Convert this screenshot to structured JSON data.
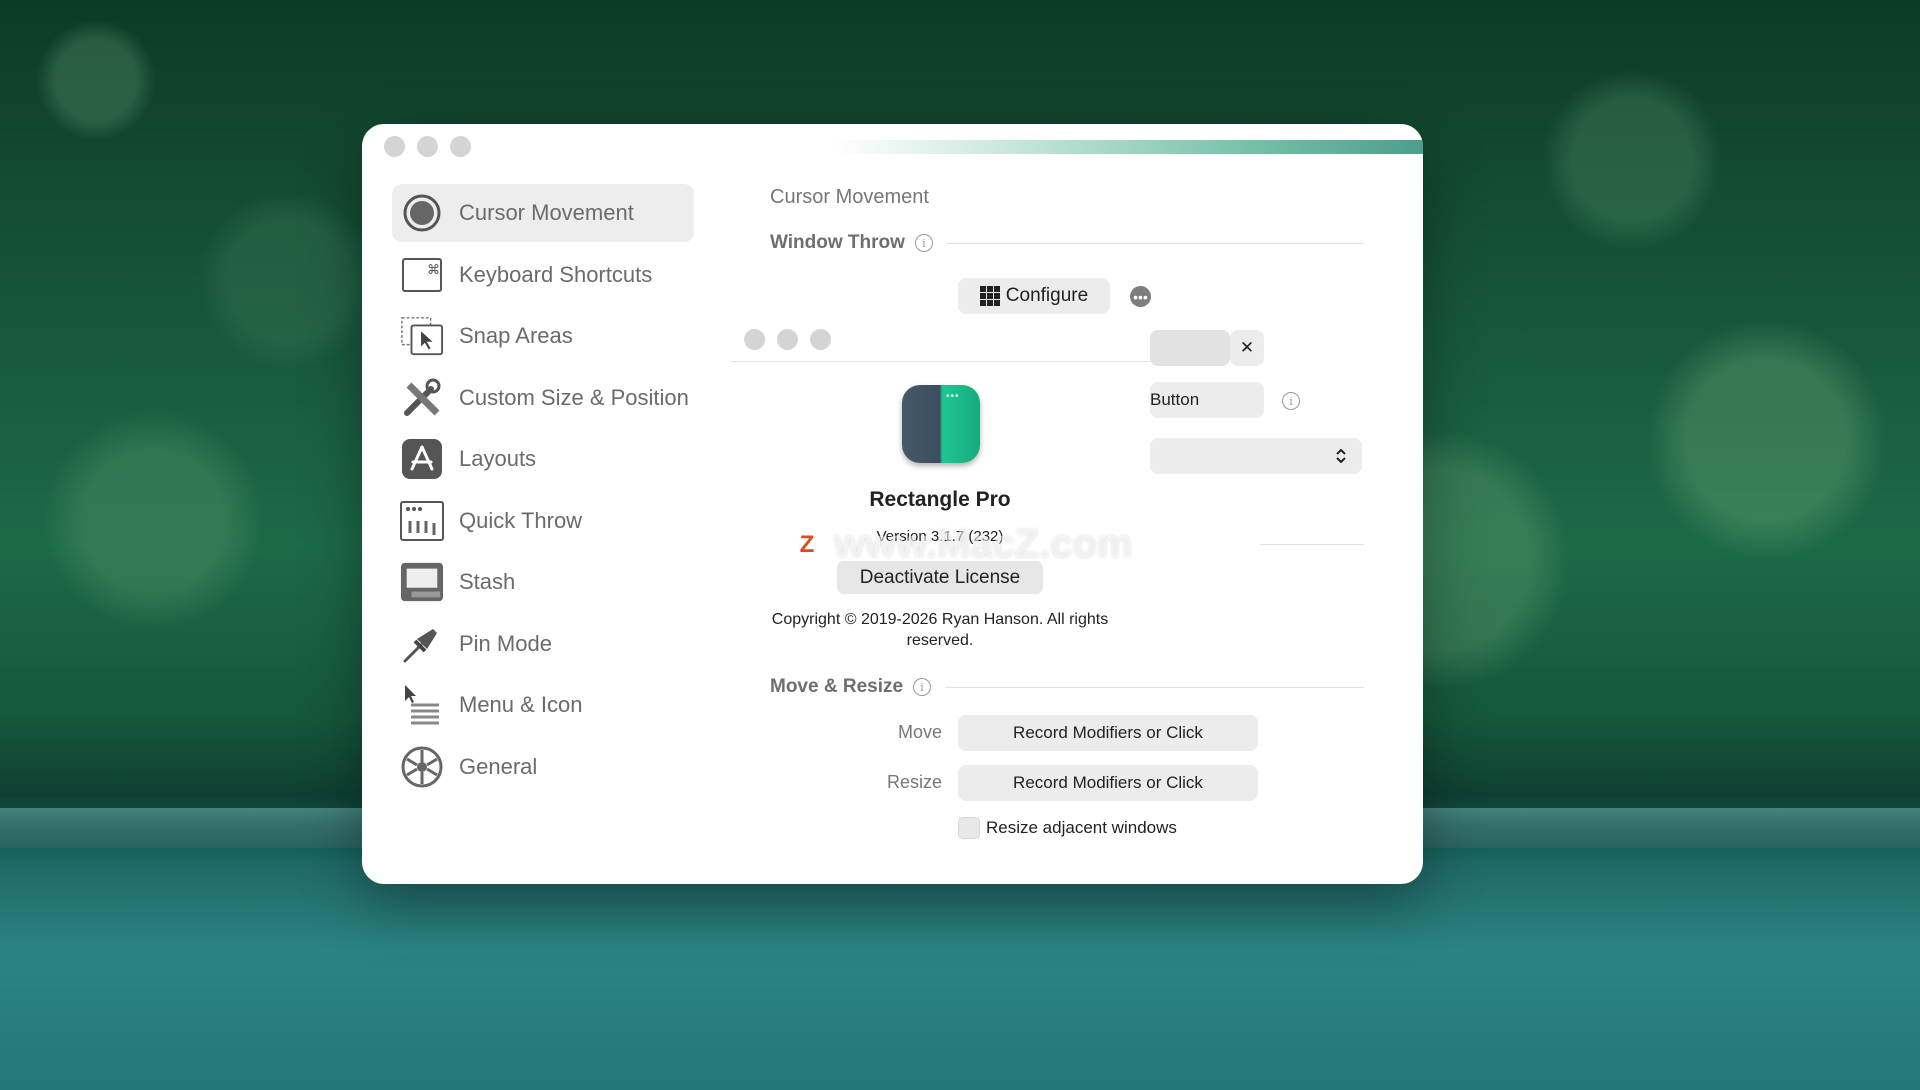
{
  "window": {
    "sidebar": {
      "items": [
        {
          "label": "Cursor Movement",
          "icon": "cursor-movement-icon",
          "selected": true
        },
        {
          "label": "Keyboard Shortcuts",
          "icon": "command-key-icon"
        },
        {
          "label": "Snap Areas",
          "icon": "snap-areas-icon"
        },
        {
          "label": "Custom Size & Position",
          "icon": "wrench-ruler-icon"
        },
        {
          "label": "Layouts",
          "icon": "layouts-icon"
        },
        {
          "label": "Quick Throw",
          "icon": "quick-throw-icon"
        },
        {
          "label": "Stash",
          "icon": "stash-icon"
        },
        {
          "label": "Pin Mode",
          "icon": "pin-icon"
        },
        {
          "label": "Menu & Icon",
          "icon": "menu-icon"
        },
        {
          "label": "General",
          "icon": "gear-icon"
        }
      ]
    },
    "content": {
      "page_title": "Cursor Movement",
      "window_throw": {
        "heading": "Window Throw",
        "configure_label": "Configure",
        "partial_button": "Button",
        "clear_symbol": "✕",
        "select_symbol": "⌃⌄"
      },
      "move_resize": {
        "heading": "Move & Resize",
        "move_label": "Move",
        "move_button": "Record Modifiers or Click",
        "resize_label": "Resize",
        "resize_button": "Record Modifiers or Click",
        "checkbox_label": "Resize adjacent windows"
      }
    }
  },
  "about": {
    "app_name": "Rectangle Pro",
    "version": "Version 3.1.7 (232)",
    "deactivate_label": "Deactivate License",
    "copyright": "Copyright © 2019-2026 Ryan Hanson. All rights reserved."
  },
  "watermark": {
    "logo_letter": "Z",
    "text": "www.MacZ.com"
  },
  "colors": {
    "accent": "#1fc794",
    "selected_bg": "#ededed",
    "button_bg": "#ececec"
  }
}
